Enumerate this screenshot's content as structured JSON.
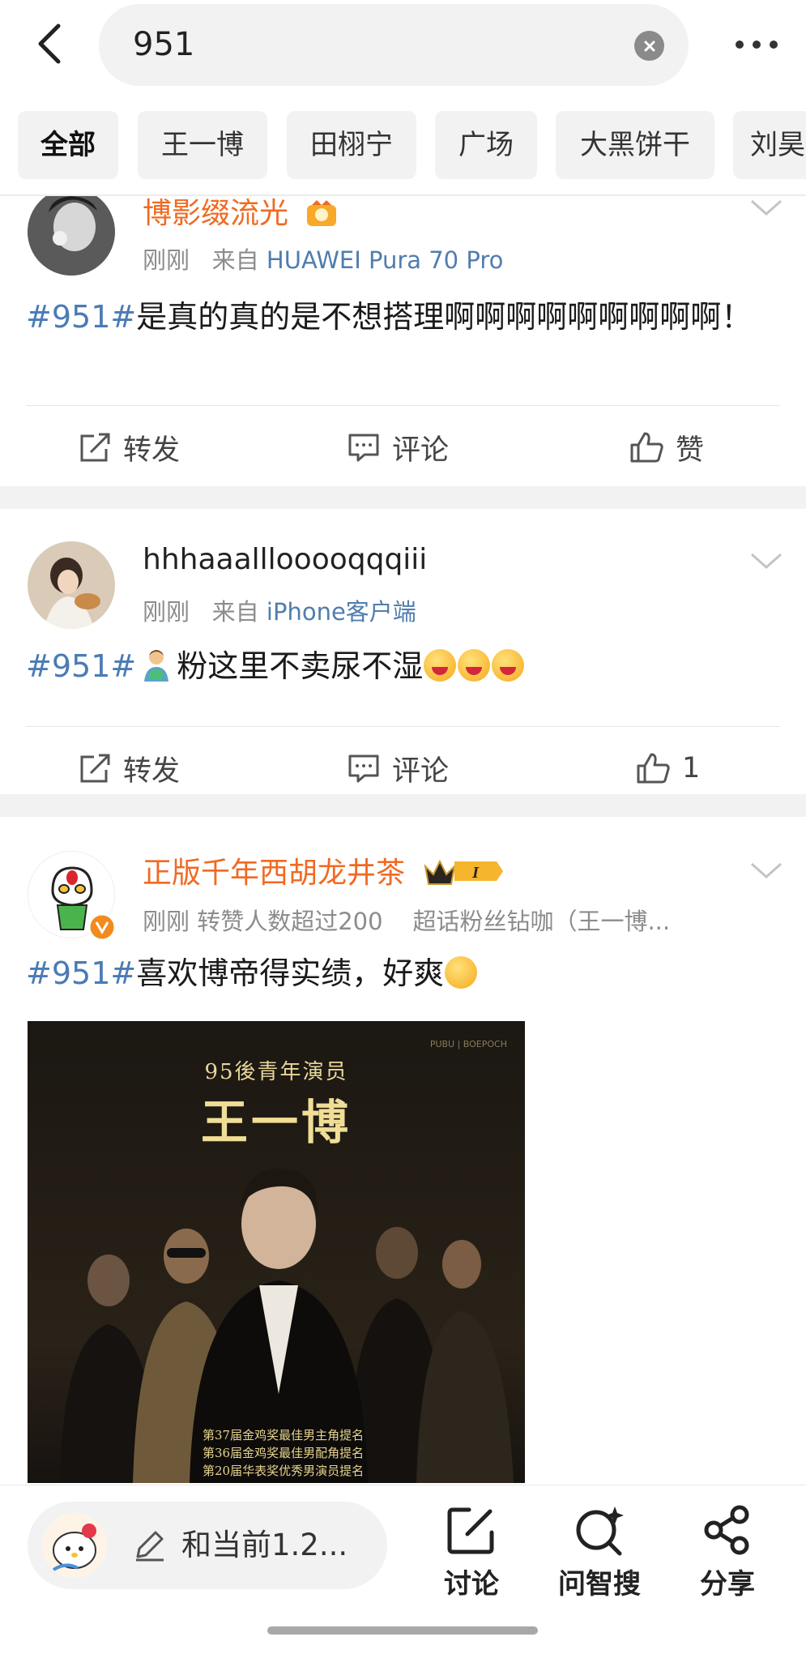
{
  "search": {
    "query": "951"
  },
  "tabs": [
    "全部",
    "王一博",
    "田栩宁",
    "广场",
    "大黑饼干",
    "刘昊"
  ],
  "posts": [
    {
      "username": "博影缀流光",
      "time": "刚刚",
      "source_prefix": "来自",
      "source": "HUAWEI Pura 70 Pro",
      "hashtag": "#951#",
      "text": "是真的真的是不想搭理啊啊啊啊啊啊啊啊啊！",
      "actions": {
        "repost": "转发",
        "comment": "评论",
        "like": "赞"
      }
    },
    {
      "username": "hhhaaalllooooqqqiii",
      "time": "刚刚",
      "source_prefix": "来自",
      "source": "iPhone客户端",
      "hashtag": "#951#",
      "text": "粉这里不卖尿不湿",
      "actions": {
        "repost": "转发",
        "comment": "评论",
        "like": "1"
      }
    },
    {
      "username": "正版千年西胡龙井茶",
      "time": "刚刚",
      "meta_extra": "转赞人数超过200",
      "meta_fan": "超话粉丝钻咖（王一博...",
      "hashtag": "#951#",
      "text": "喜欢博帝得实绩，好爽",
      "badge_level": "I",
      "image": {
        "subtitle": "95後青年演员",
        "title": "王一博",
        "corner": "PUBU | BOEPOCH",
        "notes": [
          "第37届金鸡奖最佳男主角提名",
          "第36届金鸡奖最佳男配角提名",
          "第20届华表奖优秀男演员提名"
        ]
      }
    }
  ],
  "bottom": {
    "comment_placeholder": "和当前1.2...",
    "discuss": "讨论",
    "ai_search": "问智搜",
    "share": "分享"
  },
  "colors": {
    "hashtag": "#4a7bb5",
    "vip_name": "#f06a22",
    "source": "#507daf"
  }
}
